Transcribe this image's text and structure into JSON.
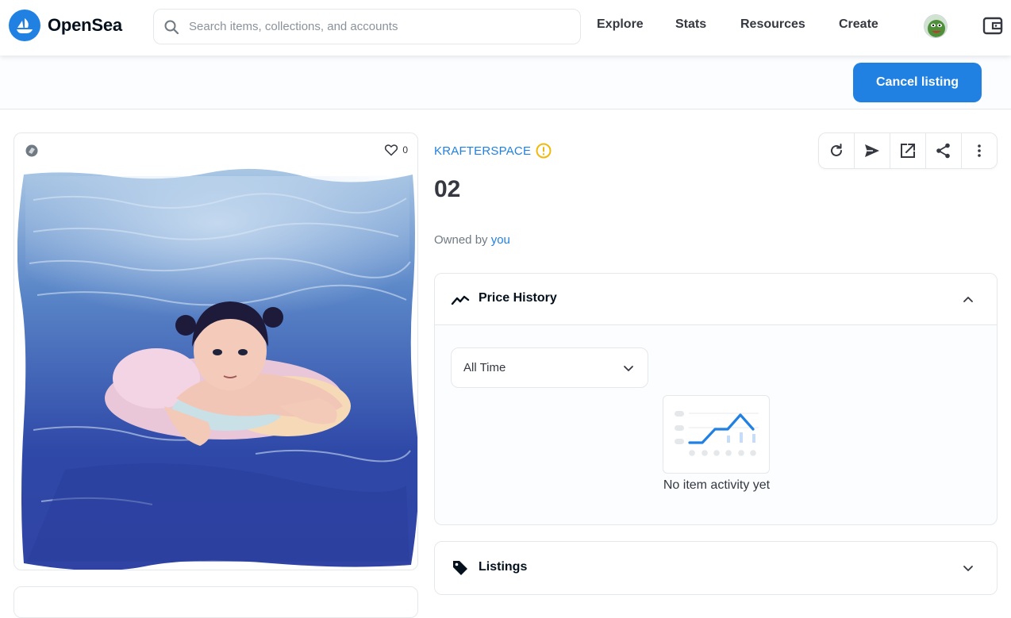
{
  "header": {
    "brand": "OpenSea",
    "search": {
      "placeholder": "Search items, collections, and accounts"
    },
    "nav_links": [
      "Explore",
      "Stats",
      "Resources",
      "Create"
    ],
    "icons": {
      "logo": "opensea-logo-icon",
      "search": "search-icon",
      "avatar": "avatar",
      "wallet": "wallet-icon"
    }
  },
  "action_bar": {
    "cancel_label": "Cancel listing"
  },
  "item": {
    "favorites": "0",
    "collection": "KRAFTERSPACE",
    "collection_status_icon": "warning-icon",
    "title": "02",
    "owned_by_prefix": "Owned by",
    "owner": "you"
  },
  "toolbar": {
    "icons": [
      "refresh-icon",
      "transfer-icon",
      "external-link-icon",
      "share-icon",
      "more-icon"
    ]
  },
  "price_history": {
    "title": "Price History",
    "range": "All Time",
    "empty_message": "No item activity yet"
  },
  "listings": {
    "title": "Listings"
  },
  "colors": {
    "accent": "#2081e2",
    "warning": "#f0b90b",
    "text": "#04111d",
    "muted": "#707a83",
    "border": "#e5e8eb"
  }
}
